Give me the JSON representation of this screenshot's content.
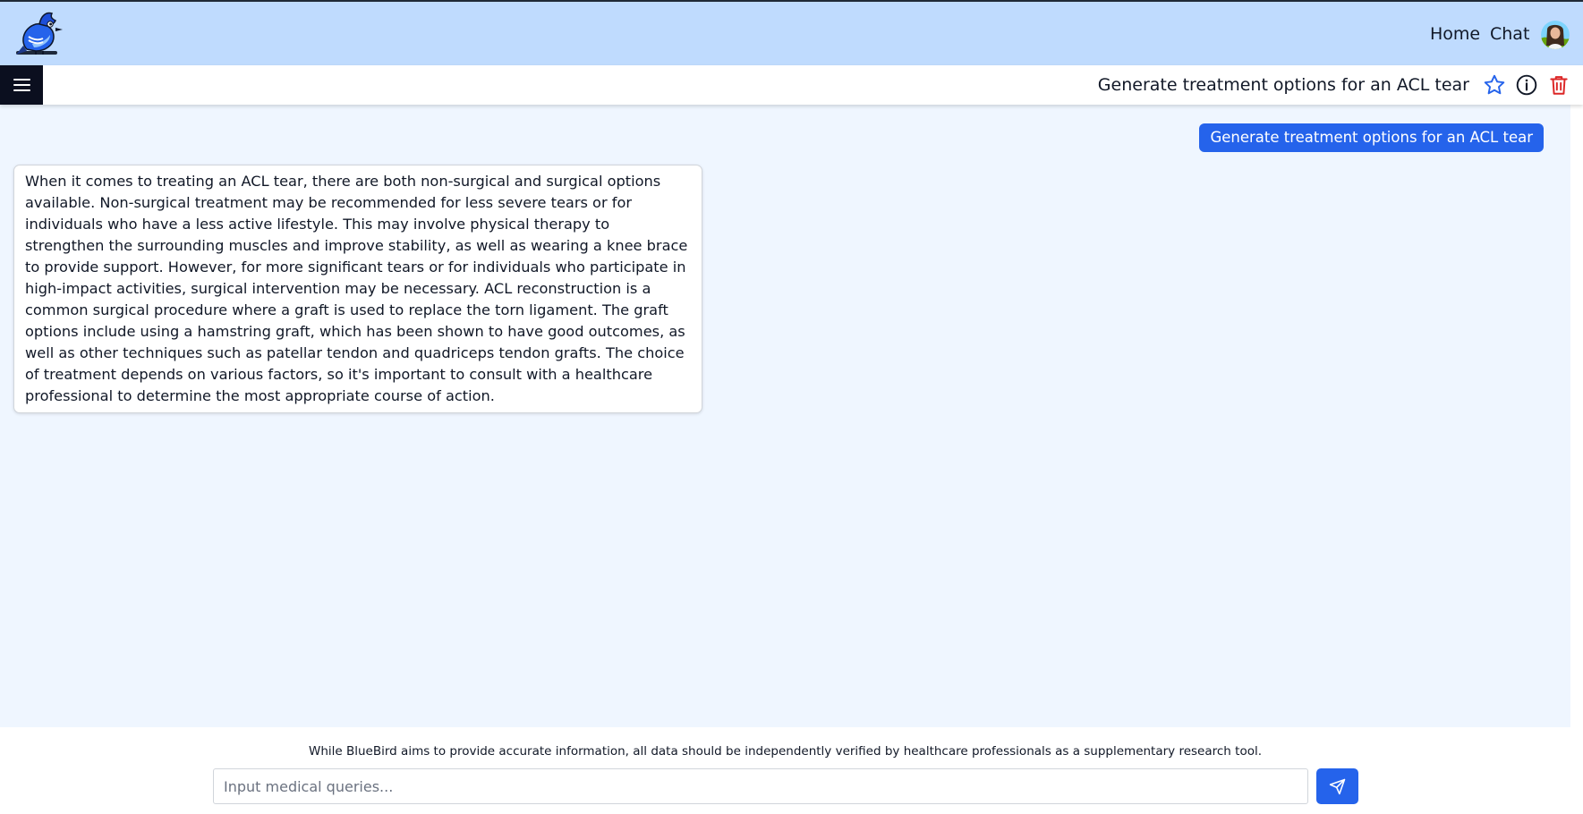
{
  "topbar": {
    "nav": [
      {
        "label": "Home"
      },
      {
        "label": "Chat"
      }
    ],
    "logo_icon": "bluebird-logo",
    "avatar_icon": "user-avatar"
  },
  "subheader": {
    "menu_icon": "hamburger-menu-icon",
    "title": "Generate treatment options for an ACL tear",
    "actions": [
      {
        "name": "favorite",
        "icon": "star-icon",
        "color": "#2563eb"
      },
      {
        "name": "info",
        "icon": "info-icon",
        "color": "#111827"
      },
      {
        "name": "delete",
        "icon": "trash-icon",
        "color": "#dc2626"
      }
    ]
  },
  "chat": {
    "messages": [
      {
        "role": "user",
        "text": "Generate treatment options for an ACL tear"
      },
      {
        "role": "assistant",
        "text": "When it comes to treating an ACL tear, there are both non-surgical and surgical options available. Non-surgical treatment may be recommended for less severe tears or for individuals who have a less active lifestyle. This may involve physical therapy to strengthen the surrounding muscles and improve stability, as well as wearing a knee brace to provide support. However, for more significant tears or for individuals who participate in high-impact activities, surgical intervention may be necessary. ACL reconstruction is a common surgical procedure where a graft is used to replace the torn ligament. The graft options include using a hamstring graft, which has been shown to have good outcomes, as well as other techniques such as patellar tendon and quadriceps tendon grafts. The choice of treatment depends on various factors, so it's important to consult with a healthcare professional to determine the most appropriate course of action."
      }
    ]
  },
  "footer": {
    "disclaimer": "While BlueBird aims to provide accurate information, all data should be independently verified by healthcare professionals as a supplementary research tool.",
    "input": {
      "placeholder": "Input medical queries...",
      "value": ""
    },
    "send_icon": "send-icon"
  },
  "colors": {
    "topbar_bg": "#bfdbfe",
    "chat_bg": "#eff6ff",
    "accent": "#2563eb",
    "menu_bg": "#0b0f1f",
    "danger": "#dc2626"
  }
}
